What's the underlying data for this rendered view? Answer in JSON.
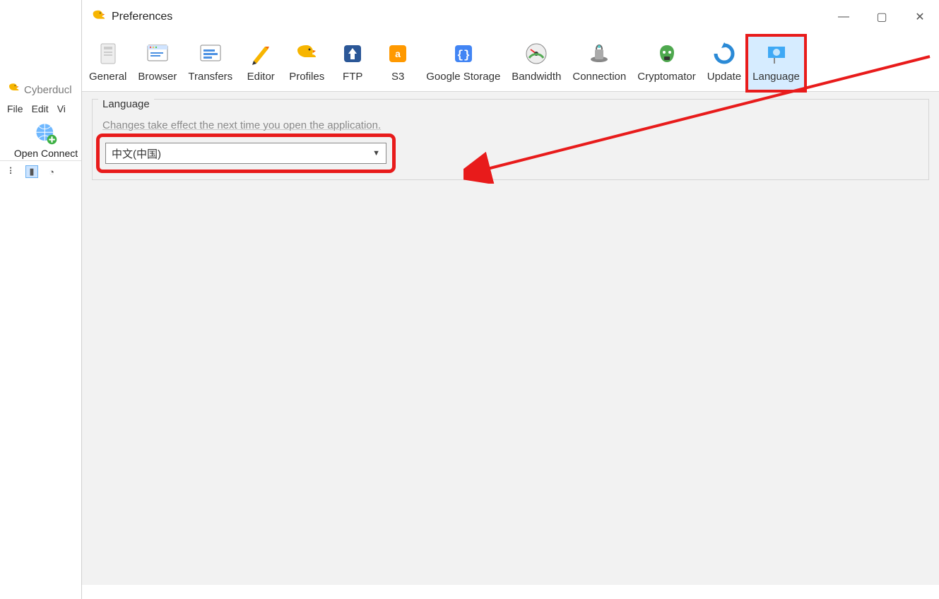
{
  "background_window": {
    "title": "Cyberducl",
    "menu": [
      "File",
      "Edit",
      "Vi"
    ],
    "open_connect_label": "Open Connect"
  },
  "preferences": {
    "title": "Preferences",
    "window_controls": {
      "min": "—",
      "max": "▢",
      "close": "✕"
    },
    "tabs": [
      {
        "label": "General",
        "icon": "general-icon"
      },
      {
        "label": "Browser",
        "icon": "browser-icon"
      },
      {
        "label": "Transfers",
        "icon": "transfers-icon"
      },
      {
        "label": "Editor",
        "icon": "editor-icon"
      },
      {
        "label": "Profiles",
        "icon": "profiles-icon"
      },
      {
        "label": "FTP",
        "icon": "ftp-icon"
      },
      {
        "label": "S3",
        "icon": "s3-icon"
      },
      {
        "label": "Google Storage",
        "icon": "google-storage-icon"
      },
      {
        "label": "Bandwidth",
        "icon": "bandwidth-icon"
      },
      {
        "label": "Connection",
        "icon": "connection-icon"
      },
      {
        "label": "Cryptomator",
        "icon": "cryptomator-icon"
      },
      {
        "label": "Update",
        "icon": "update-icon"
      },
      {
        "label": "Language",
        "icon": "language-icon",
        "selected": true
      }
    ],
    "language_section": {
      "legend": "Language",
      "help": "Changes take effect the next time you open the application.",
      "selected": "中文(中国)"
    }
  }
}
